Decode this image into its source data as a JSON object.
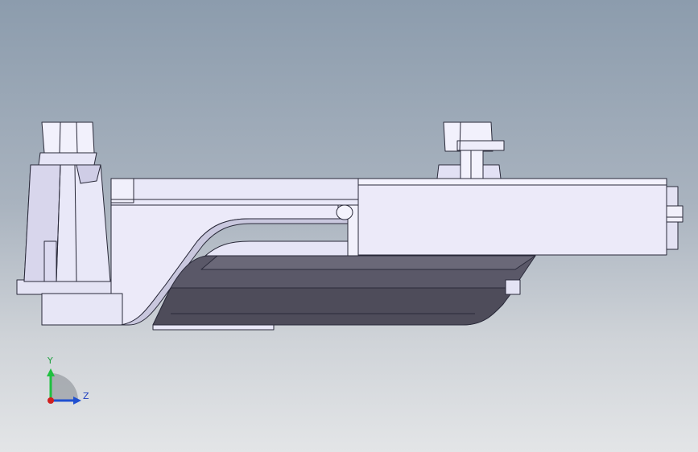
{
  "viewport": {
    "background_top": "#8c9cad",
    "background_bottom": "#e3e5e7"
  },
  "model": {
    "body_color": "#e9e8f8",
    "edge_color": "#2a2a3a",
    "shade_color": "#5a5868",
    "dark_color": "#403e4c"
  },
  "triad": {
    "y_label": "Y",
    "z_label": "Z",
    "x_color": "#d02020",
    "y_color": "#20c040",
    "z_color": "#2050d0"
  }
}
